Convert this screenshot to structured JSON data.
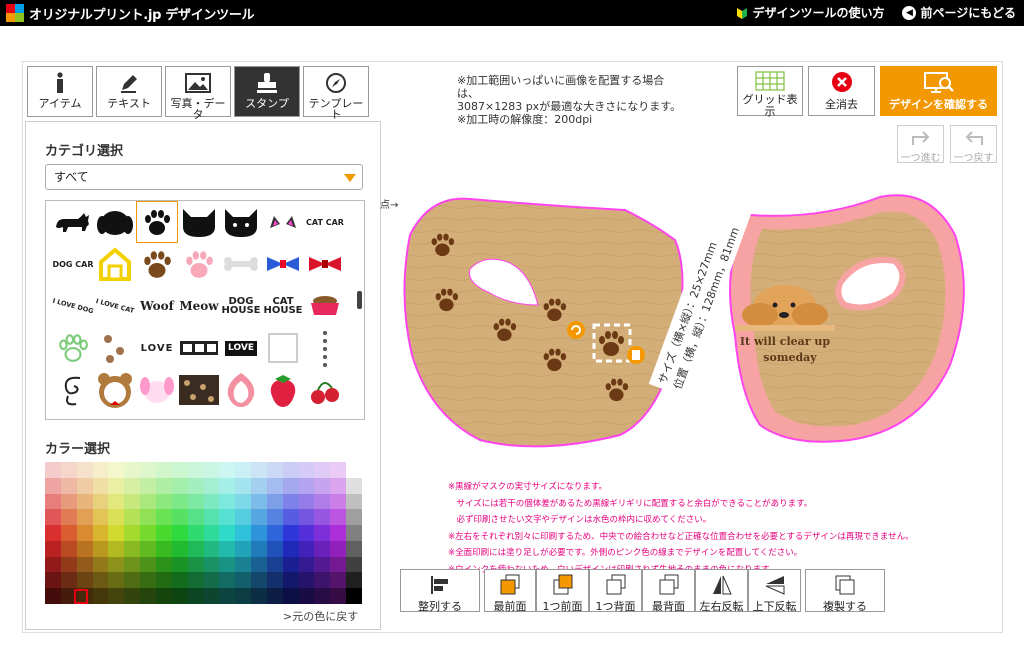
{
  "header": {
    "logo_text": "オリジナルプリント.jp デザインツール",
    "links": [
      {
        "label": "デザインツールの使い方",
        "icon": "beginner-leaf-icon"
      },
      {
        "label": "前ページにもどる",
        "icon": "back-circle-icon"
      }
    ]
  },
  "tabs": [
    {
      "label": "アイテム",
      "icon": "info-i-icon"
    },
    {
      "label": "テキスト",
      "icon": "pen-icon"
    },
    {
      "label": "写真・データ",
      "icon": "image-icon"
    },
    {
      "label": "スタンプ",
      "icon": "stamp-icon",
      "active": true
    },
    {
      "label": "テンプレート",
      "icon": "compass-icon"
    }
  ],
  "category": {
    "title": "カテゴリ選択",
    "selected": "すべて"
  },
  "stamps": [
    "cat-silhouette",
    "dog-silhouette",
    "paw-print",
    "cat-face",
    "cat-face-2",
    "cat-ears",
    "CAT CAR",
    "DOG CAR",
    "doghouse",
    "paw-brown",
    "paw-pink",
    "bone",
    "bow-blue",
    "bow-red",
    "I LOVE DOG",
    "I LOVE CAT",
    "Woof",
    "Meow",
    "DOG HOUSE",
    "CAT HOUSE",
    "dog-bowl",
    "paw-outline-green",
    "paws-small",
    "LOVE",
    "film",
    "LOVE",
    "frame",
    "paw-trail",
    "swirl",
    "bear-frame",
    "bunny",
    "leopard",
    "strawberry-cream",
    "strawberry",
    "cherries"
  ],
  "stamp_texts": {
    "cat_car": "CAT CAR",
    "dog_car": "DOG CAR",
    "i_love_dog": "I LOVE DOG",
    "i_love_cat": "I LOVE CAT",
    "woof": "Woof",
    "meow": "Meow",
    "dog_house": "DOG HOUSE",
    "cat_house": "CAT HOUSE",
    "love": "LOVE"
  },
  "color": {
    "title": "カラー選択",
    "revert": ">元の色に戻す"
  },
  "info": {
    "line1": "※加工範囲いっぱいに画像を配置する場合は、",
    "line2": "3087×1283 pxが最適な大きさになります。",
    "line3": "※加工時の解像度：200dpi"
  },
  "toolbar": {
    "grid": "グリッド表示",
    "clear": "全消去",
    "confirm": "デザインを確認する",
    "redo": "一つ進む",
    "undo": "一つ戻す"
  },
  "canvas": {
    "side_label": "点→",
    "size_label": "サイズ（横×縦）：25×27mm",
    "pos_label": "位置（横，縦）：128mm，81mm",
    "mask_text_1": "It will clear up",
    "mask_text_2": "someday"
  },
  "notes": [
    "※黒線がマスクの実寸サイズになります。",
    "　サイズには若干の個体差があるため黒線ギリギリに配置すると余白ができることがあります。",
    "　必ず印刷させたい文字やデザインは水色の枠内に収めてください。",
    "※左右をそれぞれ別々に印刷するため、中央での絵合わせなど正確な位置合わせを必要とするデザインは再現できません。",
    "※全面印刷には塗り足しが必要です。外側のピンク色の線までデザインを配置してください。",
    "※白インクを使わないため、白いデザインは印刷されず生地そのままの色になります。"
  ],
  "bottom_buttons": [
    {
      "label": "整列する",
      "icon": "align-icon"
    },
    {
      "label": "最前面",
      "icon": "front-most-icon"
    },
    {
      "label": "1つ前面",
      "icon": "forward-one-icon"
    },
    {
      "label": "1つ背面",
      "icon": "backward-one-icon"
    },
    {
      "label": "最背面",
      "icon": "back-most-icon"
    },
    {
      "label": "左右反転",
      "icon": "flip-horizontal-icon"
    },
    {
      "label": "上下反転",
      "icon": "flip-vertical-icon"
    },
    {
      "label": "複製する",
      "icon": "duplicate-icon"
    }
  ],
  "colors": {
    "accent": "#f39800",
    "mask_fabric": "#d7b07a",
    "mask_pink": "#f5b5b5",
    "bleed_line": "#ff44ee",
    "note_text": "#e6007e"
  }
}
